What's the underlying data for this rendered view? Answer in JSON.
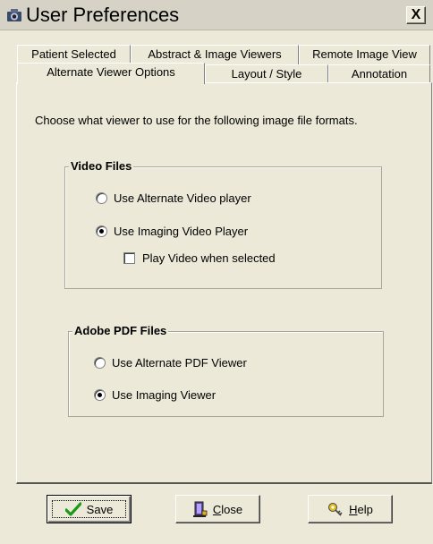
{
  "window": {
    "title": "User Preferences",
    "close_label": "X"
  },
  "tabs": {
    "row1": [
      "Patient Selected",
      "Abstract & Image Viewers",
      "Remote Image View"
    ],
    "row2": [
      "Alternate Viewer Options",
      "Layout / Style",
      "Annotation"
    ],
    "active": "Alternate Viewer Options"
  },
  "intro": "Choose what viewer to use for the following image file formats.",
  "video": {
    "legend": "Video Files",
    "opt_alternate": "Use Alternate Video player",
    "opt_imaging": "Use Imaging Video Player",
    "selected": "Use Imaging Video Player",
    "play_checkbox": "Play Video when selected",
    "play_checked": false
  },
  "pdf": {
    "legend": "Adobe PDF Files",
    "opt_alternate": "Use Alternate PDF Viewer",
    "opt_imaging": "Use Imaging Viewer",
    "selected": "Use Imaging Viewer"
  },
  "buttons": {
    "save": "Save",
    "close_mnemonic": "C",
    "close_rest": "lose",
    "help_mnemonic": "H",
    "help_rest": "elp"
  },
  "icons": {
    "app": "camera-icon",
    "save": "checkmark-icon",
    "close": "door-exit-icon",
    "help": "help-key-icon"
  }
}
